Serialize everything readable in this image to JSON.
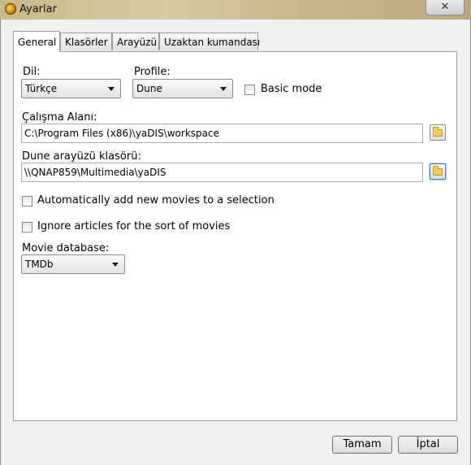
{
  "window": {
    "title": "Ayarlar",
    "close_label": "✕"
  },
  "tabs": [
    {
      "label": "General",
      "active": true
    },
    {
      "label": "Klasörler",
      "active": false
    },
    {
      "label": "Arayüzü",
      "active": false
    },
    {
      "label": "Uzaktan kumandası",
      "active": false
    }
  ],
  "general": {
    "language_label": "Dil:",
    "language_value": "Türkçe",
    "profile_label": "Profile:",
    "profile_value": "Dune",
    "basic_mode_label": "Basic mode",
    "basic_mode_checked": false,
    "workspace_label": "Çalışma Alanı:",
    "workspace_value": "C:\\Program Files (x86)\\yaDIS\\workspace",
    "dune_folder_label": "Dune arayüzü klasörü:",
    "dune_folder_value": "\\\\QNAP859\\Multimedia\\yaDIS",
    "auto_add_label": "Automatically add new movies to a selection",
    "auto_add_checked": false,
    "ignore_articles_label": "Ignore articles for the sort of movies",
    "ignore_articles_checked": false,
    "movie_db_label": "Movie database:",
    "movie_db_value": "TMDb"
  },
  "footer": {
    "ok_label": "Tamam",
    "cancel_label": "İptal"
  },
  "icons": {
    "app": "app-icon",
    "folder": "folder-icon",
    "dropdown": "chevron-down-icon"
  }
}
